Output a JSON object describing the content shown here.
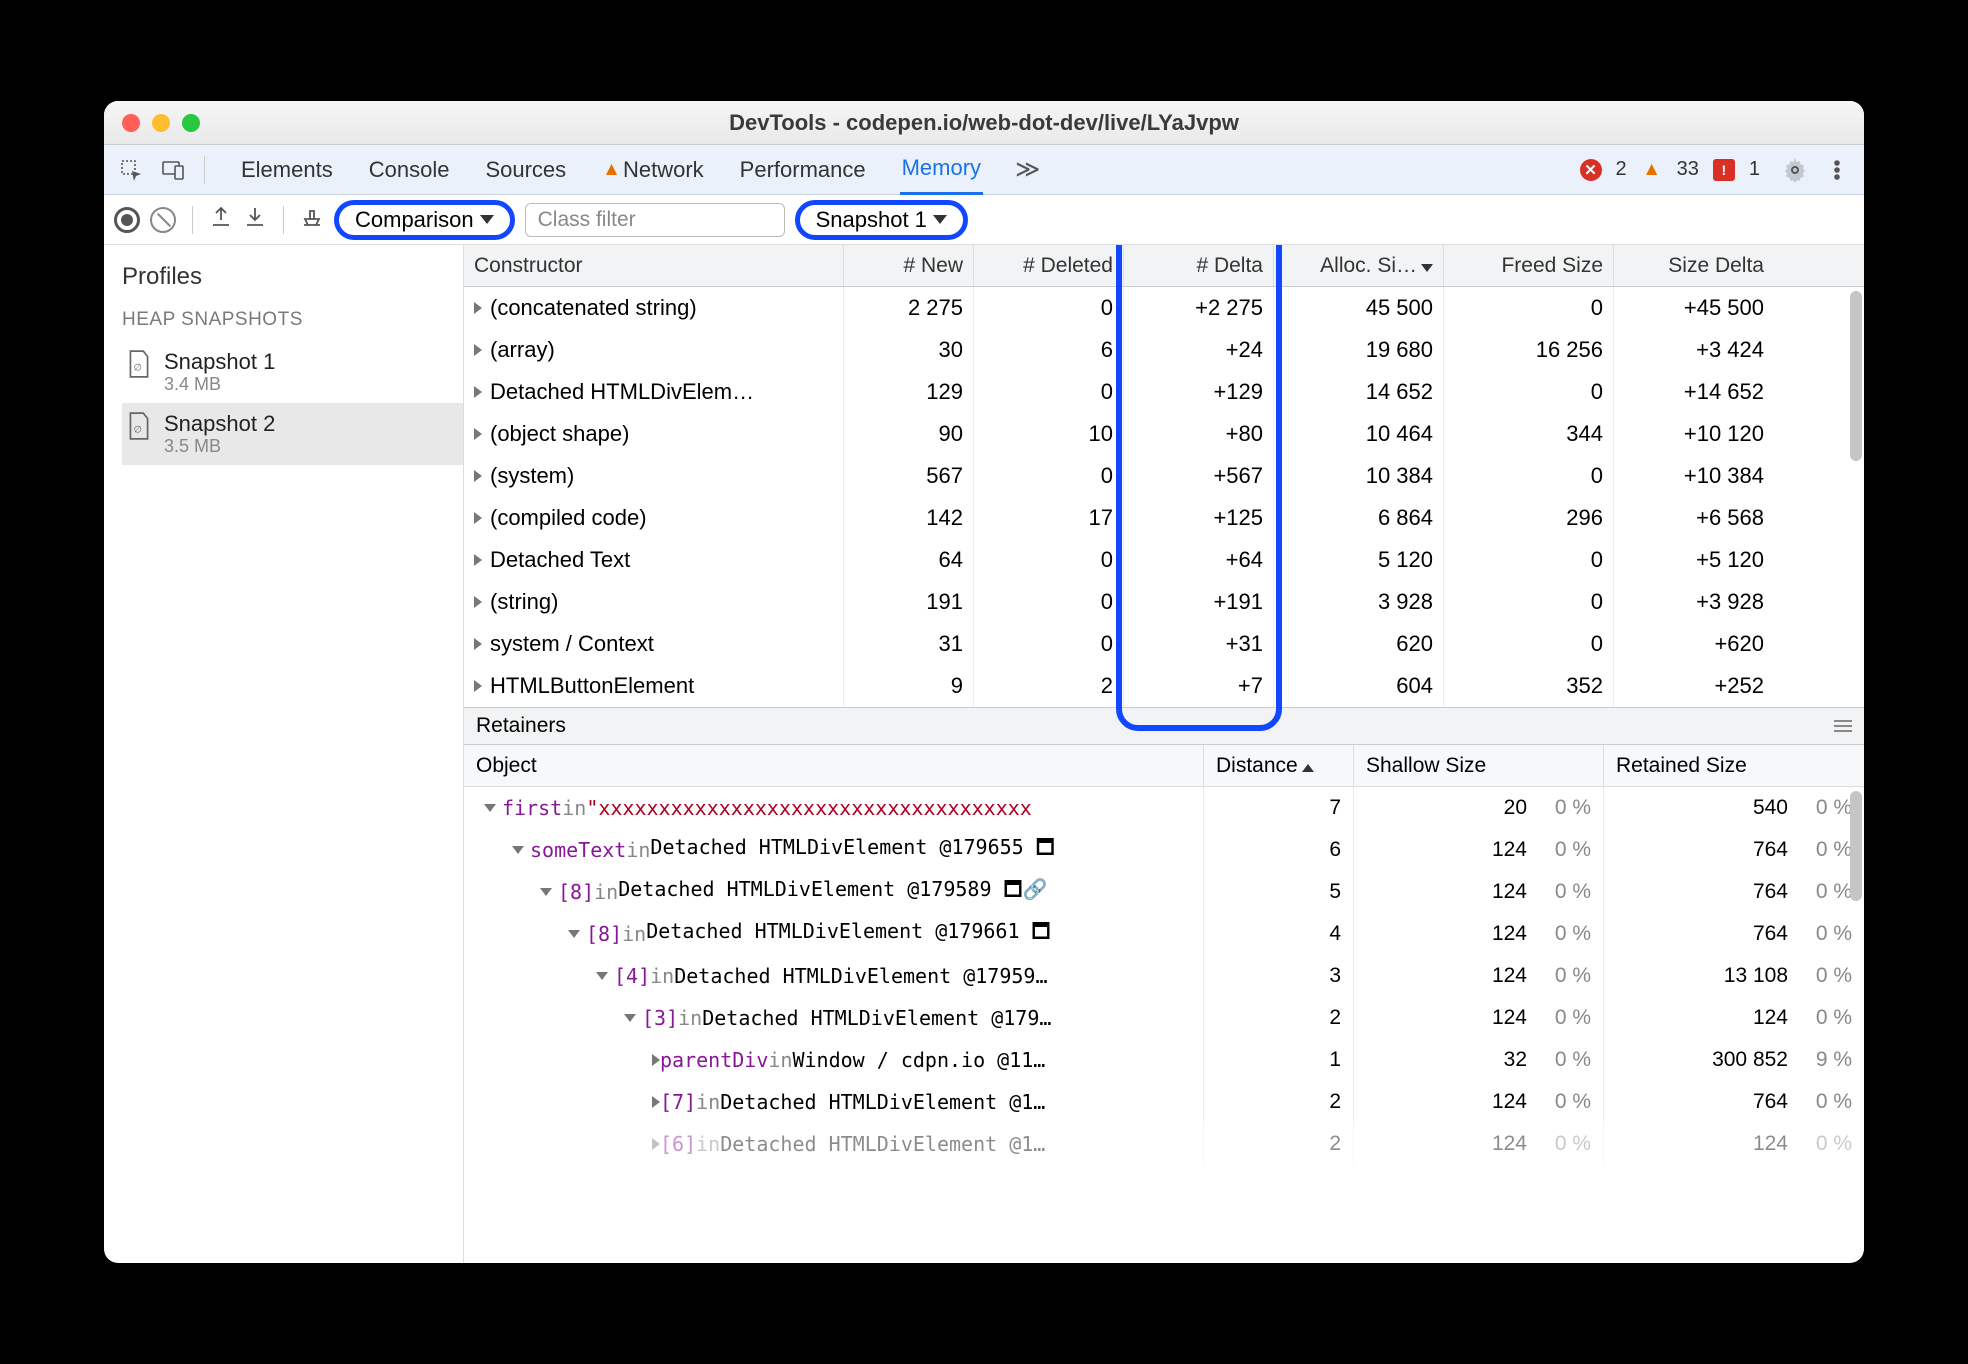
{
  "window_title": "DevTools - codepen.io/web-dot-dev/live/LYaJvpw",
  "tabs": {
    "items": [
      "Elements",
      "Console",
      "Sources",
      "Network",
      "Performance",
      "Memory"
    ],
    "network_has_warning": true,
    "active": "Memory",
    "overflow_glyph": "≫"
  },
  "status_counts": {
    "errors": 2,
    "warnings": 33,
    "messages": 1
  },
  "toolbar": {
    "view_select_label": "Comparison",
    "class_filter_placeholder": "Class filter",
    "base_select_label": "Snapshot 1"
  },
  "sidebar": {
    "title": "Profiles",
    "group_label": "HEAP SNAPSHOTS",
    "snapshots": [
      {
        "name": "Snapshot 1",
        "size": "3.4 MB",
        "selected": false
      },
      {
        "name": "Snapshot 2",
        "size": "3.5 MB",
        "selected": true
      }
    ]
  },
  "comparison_headers": [
    "Constructor",
    "# New",
    "# Deleted",
    "# Delta",
    "Alloc. Si…",
    "Freed Size",
    "Size Delta"
  ],
  "comparison_rows": [
    {
      "ctor": "(concatenated string)",
      "new": "2 275",
      "del": "0",
      "delta": "+2 275",
      "alloc": "45 500",
      "freed": "0",
      "sdelta": "+45 500"
    },
    {
      "ctor": "(array)",
      "new": "30",
      "del": "6",
      "delta": "+24",
      "alloc": "19 680",
      "freed": "16 256",
      "sdelta": "+3 424"
    },
    {
      "ctor": "Detached HTMLDivElem…",
      "new": "129",
      "del": "0",
      "delta": "+129",
      "alloc": "14 652",
      "freed": "0",
      "sdelta": "+14 652"
    },
    {
      "ctor": "(object shape)",
      "new": "90",
      "del": "10",
      "delta": "+80",
      "alloc": "10 464",
      "freed": "344",
      "sdelta": "+10 120"
    },
    {
      "ctor": "(system)",
      "new": "567",
      "del": "0",
      "delta": "+567",
      "alloc": "10 384",
      "freed": "0",
      "sdelta": "+10 384"
    },
    {
      "ctor": "(compiled code)",
      "new": "142",
      "del": "17",
      "delta": "+125",
      "alloc": "6 864",
      "freed": "296",
      "sdelta": "+6 568"
    },
    {
      "ctor": "Detached Text",
      "new": "64",
      "del": "0",
      "delta": "+64",
      "alloc": "5 120",
      "freed": "0",
      "sdelta": "+5 120"
    },
    {
      "ctor": "(string)",
      "new": "191",
      "del": "0",
      "delta": "+191",
      "alloc": "3 928",
      "freed": "0",
      "sdelta": "+3 928"
    },
    {
      "ctor": "system / Context",
      "new": "31",
      "del": "0",
      "delta": "+31",
      "alloc": "620",
      "freed": "0",
      "sdelta": "+620"
    },
    {
      "ctor": "HTMLButtonElement",
      "new": "9",
      "del": "2",
      "delta": "+7",
      "alloc": "604",
      "freed": "352",
      "sdelta": "+252"
    }
  ],
  "retainers_label": "Retainers",
  "retainers_headers": [
    "Object",
    "Distance",
    "Shallow Size",
    "Retained Size"
  ],
  "retainers_rows": [
    {
      "indent": 0,
      "open": true,
      "prop": "first",
      "in": "in",
      "ctx": "\"xxxxxxxxxxxxxxxxxxxxxxxxxxxxxxxxxxxx",
      "dist": "7",
      "shallow": "20",
      "shp": "0 %",
      "ret": "540",
      "rtp": "0 %"
    },
    {
      "indent": 1,
      "open": true,
      "prop": "someText",
      "in": "in",
      "ctx": "Detached HTMLDivElement @179655 🗖",
      "dist": "6",
      "shallow": "124",
      "shp": "0 %",
      "ret": "764",
      "rtp": "0 %"
    },
    {
      "indent": 2,
      "open": true,
      "prop": "[8]",
      "in": "in",
      "ctx": "Detached HTMLDivElement @179589 🗖🔗",
      "dist": "5",
      "shallow": "124",
      "shp": "0 %",
      "ret": "764",
      "rtp": "0 %"
    },
    {
      "indent": 3,
      "open": true,
      "prop": "[8]",
      "in": "in",
      "ctx": "Detached HTMLDivElement @179661 🗖",
      "dist": "4",
      "shallow": "124",
      "shp": "0 %",
      "ret": "764",
      "rtp": "0 %"
    },
    {
      "indent": 4,
      "open": true,
      "prop": "[4]",
      "in": "in",
      "ctx": "Detached HTMLDivElement @17959…",
      "dist": "3",
      "shallow": "124",
      "shp": "0 %",
      "ret": "13 108",
      "rtp": "0 %"
    },
    {
      "indent": 5,
      "open": true,
      "prop": "[3]",
      "in": "in",
      "ctx": "Detached HTMLDivElement @179…",
      "dist": "2",
      "shallow": "124",
      "shp": "0 %",
      "ret": "124",
      "rtp": "0 %"
    },
    {
      "indent": 6,
      "open": false,
      "prop": "parentDiv",
      "in": "in",
      "ctx": "Window / cdpn.io @11…",
      "dist": "1",
      "shallow": "32",
      "shp": "0 %",
      "ret": "300 852",
      "rtp": "9 %"
    },
    {
      "indent": 6,
      "open": false,
      "prop": "[7]",
      "in": "in",
      "ctx": "Detached HTMLDivElement @1…",
      "dist": "2",
      "shallow": "124",
      "shp": "0 %",
      "ret": "764",
      "rtp": "0 %"
    },
    {
      "indent": 6,
      "open": false,
      "prop": "[6]",
      "in": "in",
      "ctx": "Detached HTMLDivElement @1…",
      "dist": "2",
      "shallow": "124",
      "shp": "0 %",
      "ret": "124",
      "rtp": "0 %",
      "faded": true
    }
  ]
}
